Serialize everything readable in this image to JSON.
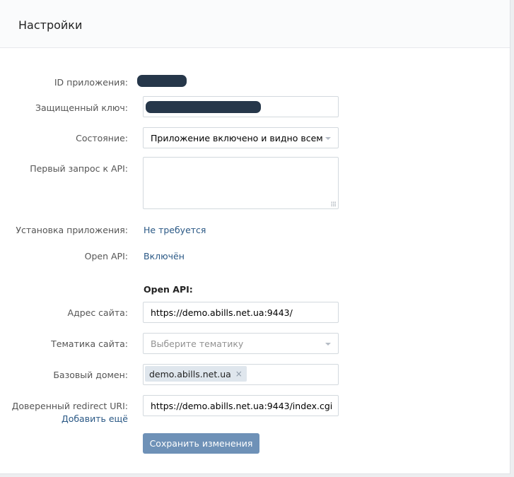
{
  "header": {
    "title": "Настройки"
  },
  "fields": {
    "app_id": {
      "label": "ID приложения:"
    },
    "secret_key": {
      "label": "Защищенный ключ:"
    },
    "state": {
      "label": "Состояние:",
      "value": "Приложение включено и видно всем"
    },
    "first_api_request": {
      "label": "Первый запрос к API:",
      "value": ""
    },
    "install": {
      "label": "Установка приложения:",
      "value": "Не требуется"
    },
    "open_api_status": {
      "label": "Open API:",
      "value": "Включён"
    }
  },
  "open_api": {
    "section_title": "Open API:",
    "site_address": {
      "label": "Адрес сайта:",
      "value": "https://demo.abills.net.ua:9443/"
    },
    "site_topic": {
      "label": "Тематика сайта:",
      "placeholder": "Выберите тематику"
    },
    "base_domain": {
      "label": "Базовый домен:",
      "token": "demo.abills.net.ua",
      "remove_glyph": "×"
    },
    "redirect_uri": {
      "label": "Доверенный redirect URI:",
      "value": "https://demo.abills.net.ua:9443/index.cgi",
      "add_more": "Добавить ещё"
    }
  },
  "actions": {
    "save_label": "Сохранить изменения"
  },
  "colors": {
    "link": "#2a5885",
    "button": "#6e91b7",
    "masked": "#26374a"
  }
}
